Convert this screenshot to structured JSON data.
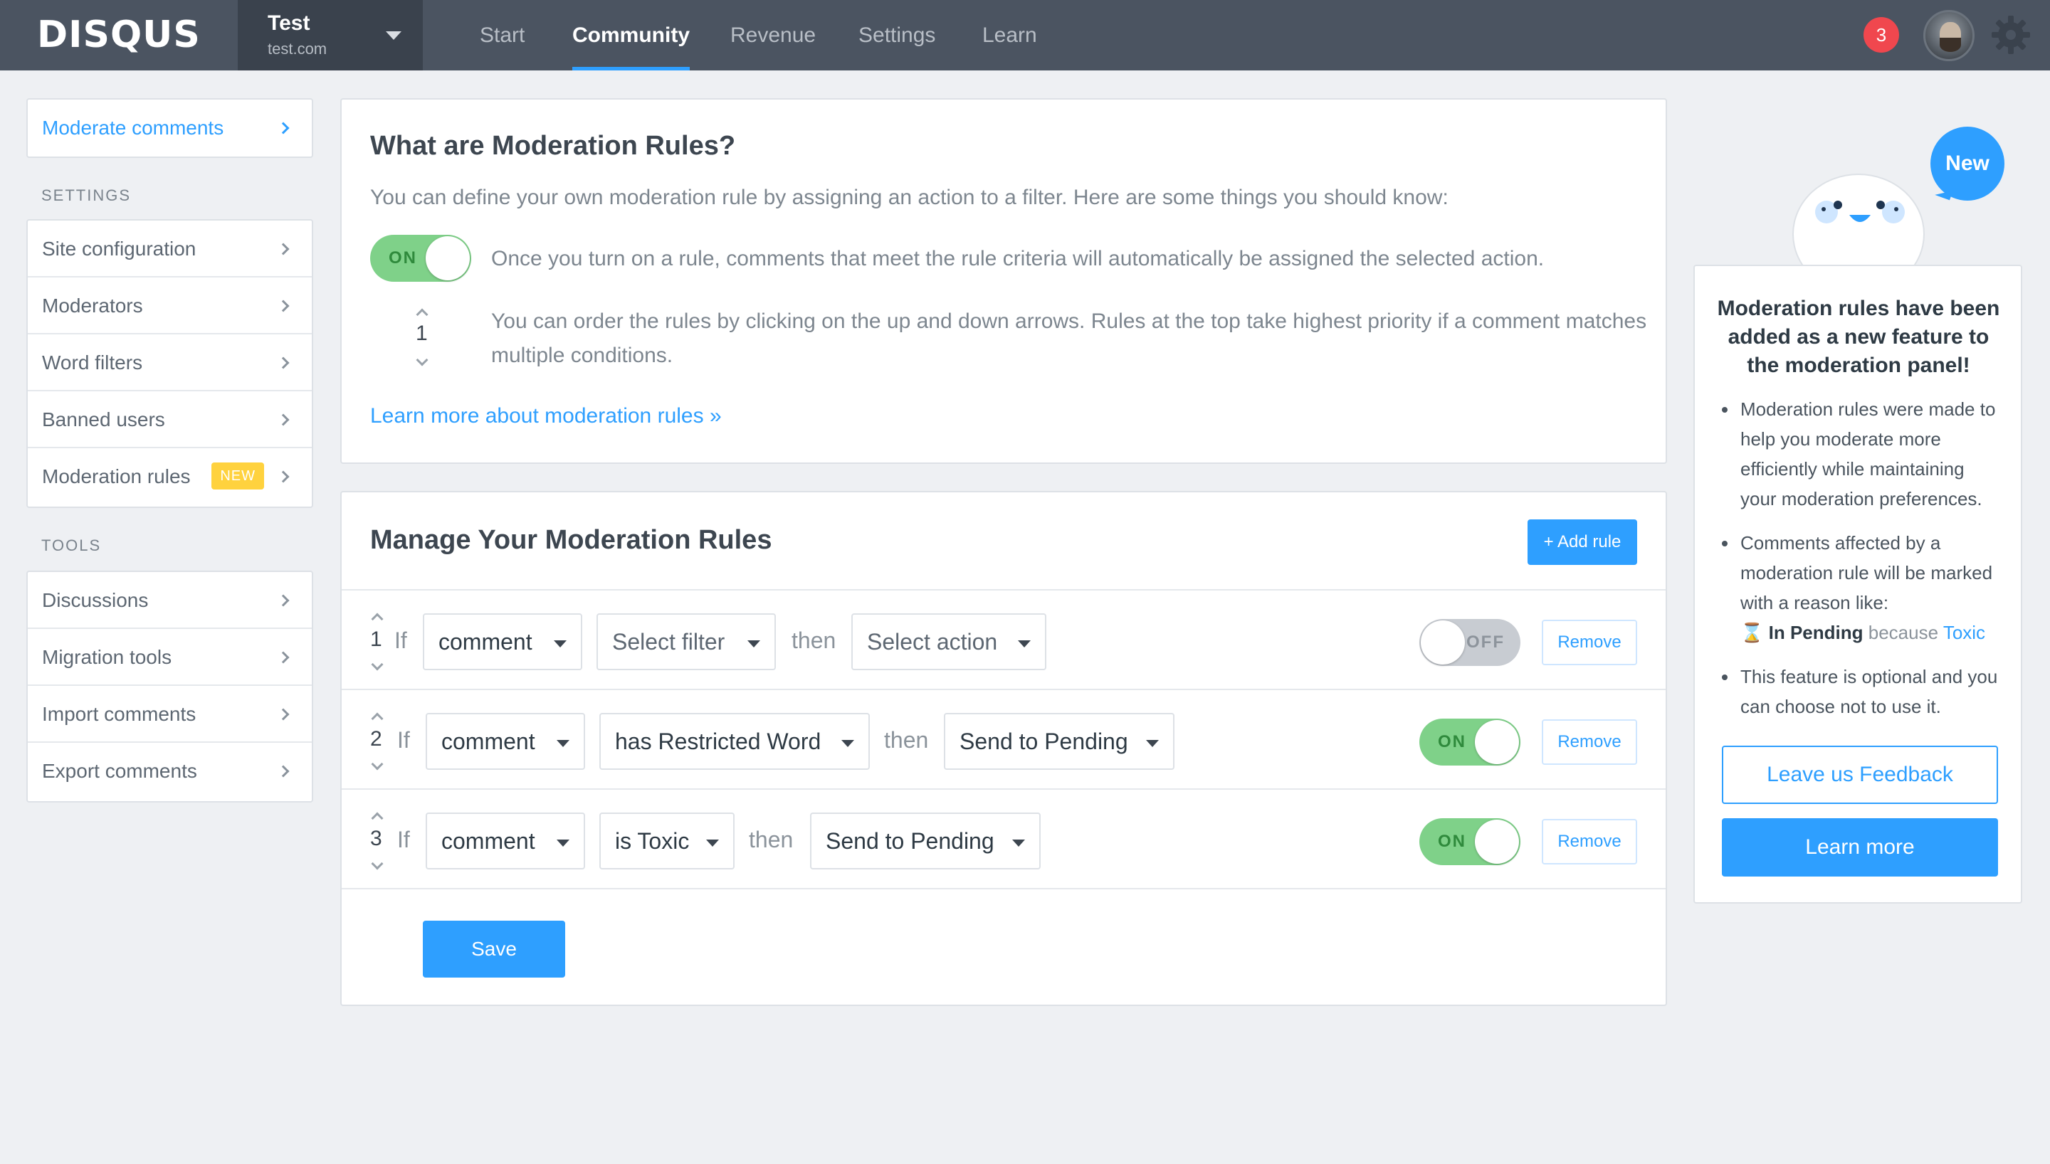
{
  "brand": {
    "logo": "DISQUS"
  },
  "site": {
    "name": "Test",
    "url": "test.com"
  },
  "nav": {
    "start": "Start",
    "community": "Community",
    "revenue": "Revenue",
    "settings": "Settings",
    "learn": "Learn"
  },
  "notifications": {
    "count": "3"
  },
  "sidebar": {
    "moderate": "Moderate comments",
    "settings_heading": "SETTINGS",
    "settings": [
      "Site configuration",
      "Moderators",
      "Word filters",
      "Banned users",
      "Moderation rules"
    ],
    "new_badge": "NEW",
    "tools_heading": "TOOLS",
    "tools": [
      "Discussions",
      "Migration tools",
      "Import comments",
      "Export comments"
    ]
  },
  "intro": {
    "title": "What are Moderation Rules?",
    "description": "You can define your own moderation rule by assigning an action to a filter. Here are some things you should know:",
    "toggle_label": "ON",
    "tip1": "Once you turn on a rule, comments that meet the rule criteria will automatically be assigned the selected action.",
    "order_example": "1",
    "tip2": "You can order the rules by clicking on the up and down arrows. Rules at the top take highest priority if a comment matches multiple conditions.",
    "learn_link": "Learn more about moderation rules »"
  },
  "manage": {
    "title": "Manage Your Moderation Rules",
    "add_rule": "+ Add rule",
    "if_word": "If",
    "then_word": "then",
    "remove_label": "Remove",
    "rules": [
      {
        "order": "1",
        "subject": "comment",
        "filter": "Select filter",
        "action": "Select action",
        "enabled": false,
        "toggle_label": "OFF"
      },
      {
        "order": "2",
        "subject": "comment",
        "filter": "has Restricted Word",
        "action": "Send to Pending",
        "enabled": true,
        "toggle_label": "ON"
      },
      {
        "order": "3",
        "subject": "comment",
        "filter": "is Toxic",
        "action": "Send to Pending",
        "enabled": true,
        "toggle_label": "ON"
      }
    ],
    "save": "Save"
  },
  "announcement": {
    "new_bubble": "New",
    "title": "Moderation rules have been added as a new feature to the moderation panel!",
    "bullet1": "Moderation rules were made to help you moderate more efficiently while maintaining your moderation preferences.",
    "bullet2_prefix": "Comments affected by a moderation rule will be marked with a reason like:",
    "bullet2_pending": "In Pending",
    "bullet2_because": "because",
    "bullet2_reason": "Toxic",
    "bullet3": "This feature is optional and you can choose not to use it.",
    "feedback_button": "Leave us Feedback",
    "learn_button": "Learn more"
  },
  "colors": {
    "accent": "#2e9fff",
    "topbar": "#4b5461",
    "toggle_on": "#7fd189",
    "badge": "#f0474e",
    "new_tag": "#ffd23e"
  },
  "icons": [
    "caret-down-icon",
    "chevron-right-icon",
    "hourglass-icon",
    "gear-icon",
    "arrow-up-icon",
    "arrow-down-icon"
  ]
}
